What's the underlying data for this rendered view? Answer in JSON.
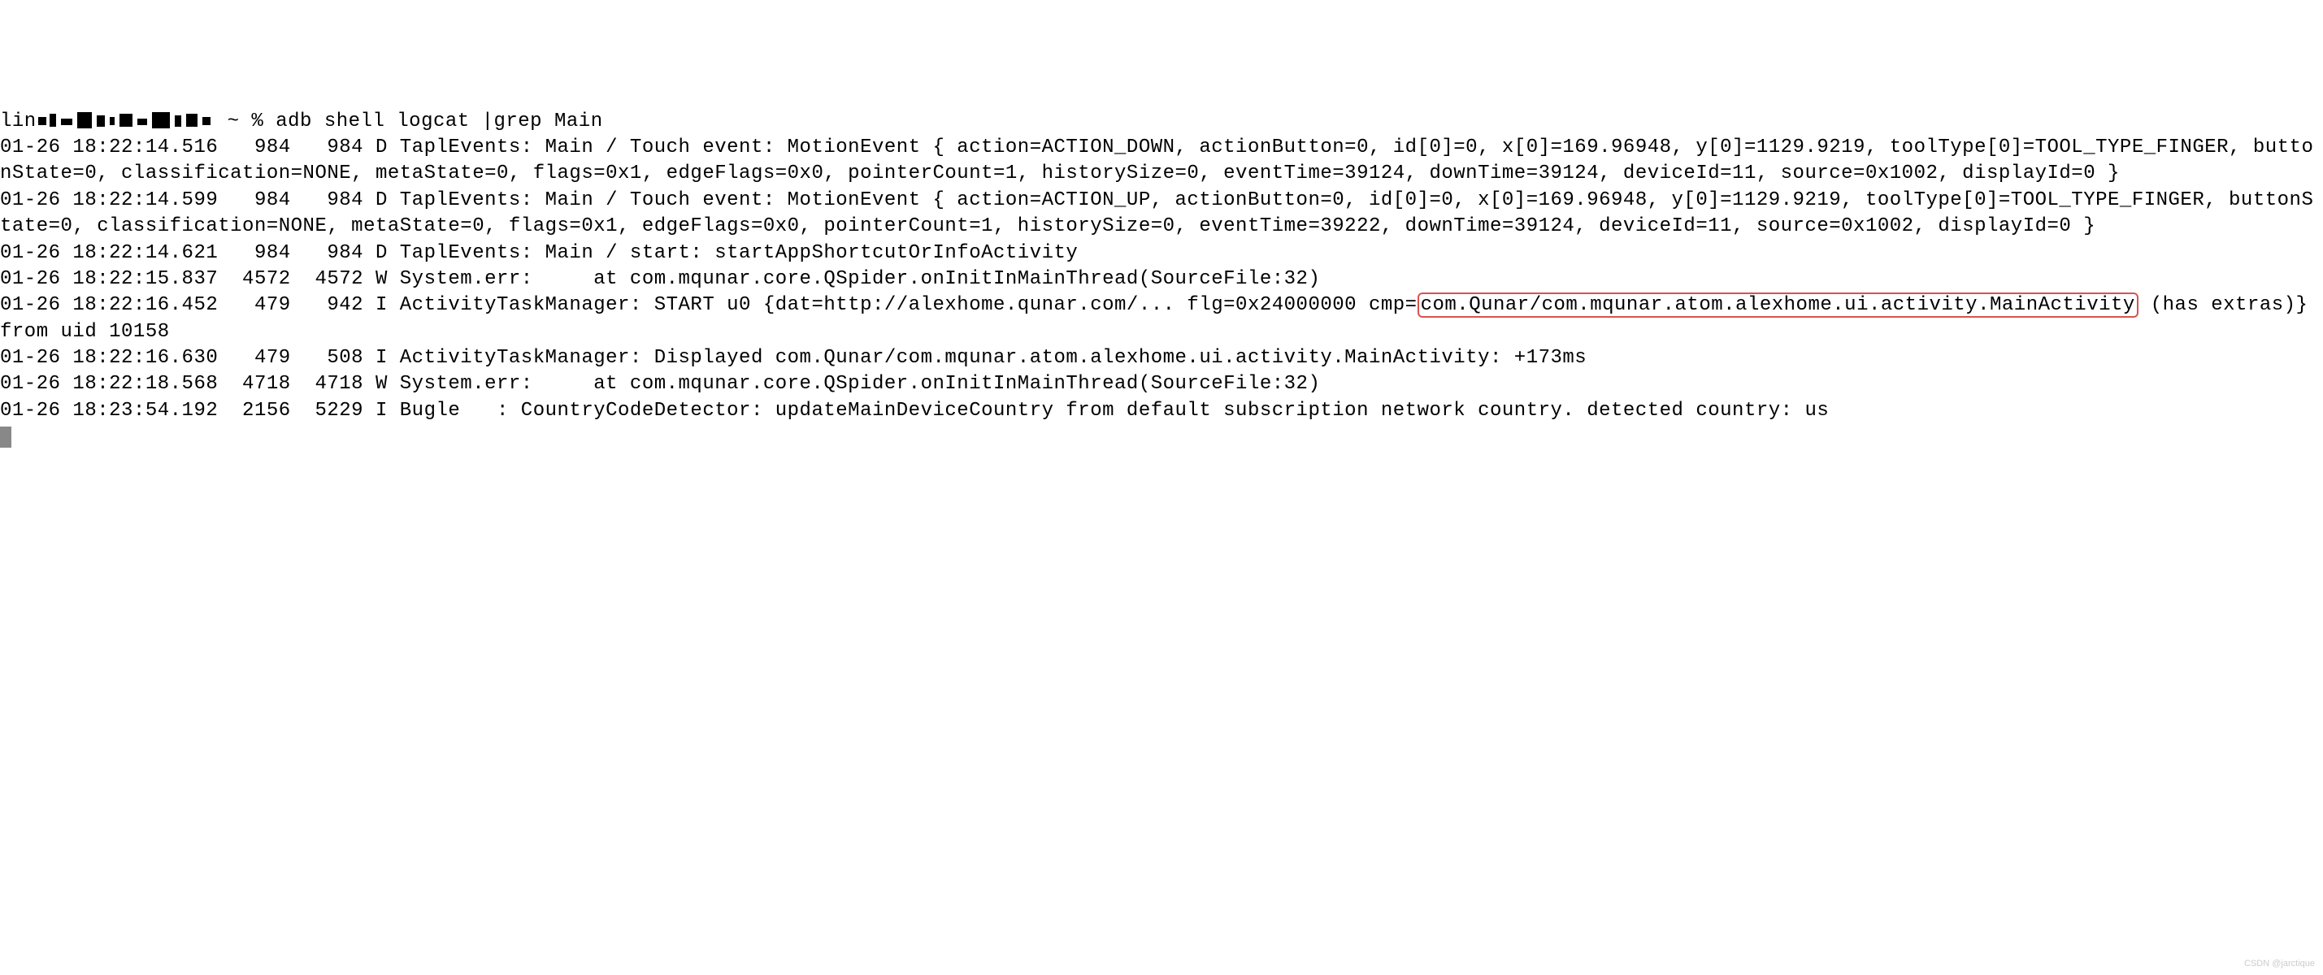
{
  "prompt": {
    "user_host_prefix": "lin",
    "user_host_suffix": " ~ % ",
    "command": "adb shell logcat |grep Main"
  },
  "lines": {
    "l1": "01-26 18:22:14.516   984   984 D TaplEvents: Main / Touch event: MotionEvent { action=ACTION_DOWN, actionButton=0, id[0]=0, x[0]=169.96948, y[0]=1129.9219, toolType[0]=TOOL_TYPE_FINGER, buttonState=0, classification=NONE, metaState=0, flags=0x1, edgeFlags=0x0, pointerCount=1, historySize=0, eventTime=39124, downTime=39124, deviceId=11, source=0x1002, displayId=0 }",
    "l2": "01-26 18:22:14.599   984   984 D TaplEvents: Main / Touch event: MotionEvent { action=ACTION_UP, actionButton=0, id[0]=0, x[0]=169.96948, y[0]=1129.9219, toolType[0]=TOOL_TYPE_FINGER, buttonState=0, classification=NONE, metaState=0, flags=0x1, edgeFlags=0x0, pointerCount=1, historySize=0, eventTime=39222, downTime=39124, deviceId=11, source=0x1002, displayId=0 }",
    "l3": "01-26 18:22:14.621   984   984 D TaplEvents: Main / start: startAppShortcutOrInfoActivity",
    "l4": "01-26 18:22:15.837  4572  4572 W System.err:     at com.mqunar.core.QSpider.onInitInMainThread(SourceFile:32)",
    "l5_pre": "01-26 18:22:16.452   479   942 I ActivityTaskManager: START u0 {dat=http://alexhome.qunar.com/... flg=0x24000000 cmp=",
    "l5_highlight": "com.Qunar/com.mqunar.atom.alexhome.ui.activity.MainActivity",
    "l5_post": " (has extras)} from uid 10158",
    "l6": "01-26 18:22:16.630   479   508 I ActivityTaskManager: Displayed com.Qunar/com.mqunar.atom.alexhome.ui.activity.MainActivity: +173ms",
    "l7": "01-26 18:22:18.568  4718  4718 W System.err:     at com.mqunar.core.QSpider.onInitInMainThread(SourceFile:32)",
    "l8": "01-26 18:23:54.192  2156  5229 I Bugle   : CountryCodeDetector: updateMainDeviceCountry from default subscription network country. detected country: us"
  },
  "watermark": "CSDN @jarctique"
}
